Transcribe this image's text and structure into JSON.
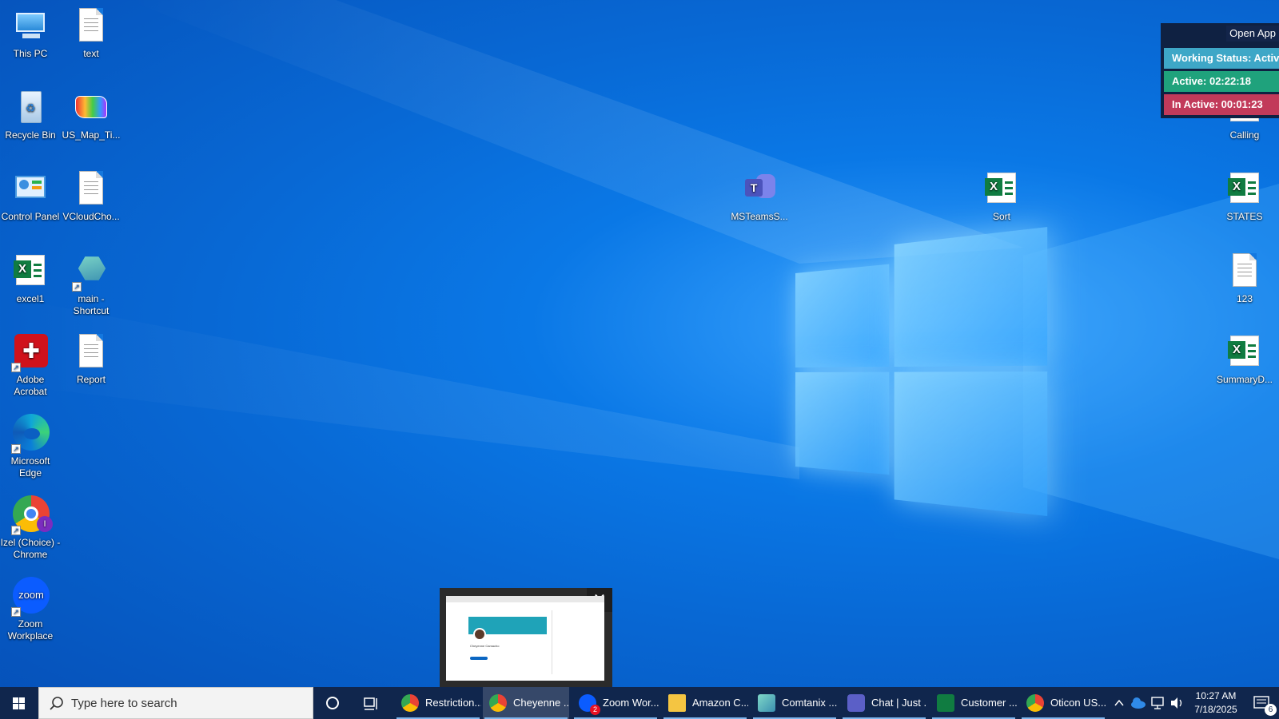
{
  "desktop": {
    "icons": [
      {
        "label": "This PC",
        "icon": "this-pc-icon"
      },
      {
        "label": "text",
        "icon": "text-file-icon"
      },
      {
        "label": "Recycle Bin",
        "icon": "recycle-bin-icon"
      },
      {
        "label": "US_Map_Ti...",
        "icon": "map-image-icon"
      },
      {
        "label": "Control Panel",
        "icon": "control-panel-icon"
      },
      {
        "label": "VCloudCho...",
        "icon": "text-file-icon"
      },
      {
        "label": "excel1",
        "icon": "excel-file-icon"
      },
      {
        "label": "main - Shortcut",
        "icon": "shortcut-icon"
      },
      {
        "label": "Adobe Acrobat",
        "icon": "adobe-acrobat-icon"
      },
      {
        "label": "Report",
        "icon": "text-file-icon"
      },
      {
        "label": "Microsoft Edge",
        "icon": "edge-icon"
      },
      {
        "label": "Izel (Choice) - Chrome",
        "icon": "chrome-icon"
      },
      {
        "label": "Zoom Workplace",
        "icon": "zoom-icon"
      },
      {
        "label": "MSTeamsS...",
        "icon": "teams-icon"
      },
      {
        "label": "Sort",
        "icon": "excel-file-icon"
      },
      {
        "label": "Calling",
        "icon": "excel-file-icon"
      },
      {
        "label": "STATES",
        "icon": "excel-file-icon"
      },
      {
        "label": "123",
        "icon": "text-file-icon"
      },
      {
        "label": "SummaryD...",
        "icon": "excel-file-icon"
      }
    ]
  },
  "widget": {
    "open_app": "Open App",
    "working_status": "Working Status: Active",
    "active": "Active: 02:22:18",
    "inactive": "In Active: 00:01:23",
    "colors": {
      "status": "#3ea7c7",
      "active": "#1fa27c",
      "inactive": "#c23a5a"
    }
  },
  "taskbar": {
    "search_placeholder": "Type here to search",
    "apps": [
      {
        "label": "Restriction...",
        "icon": "chrome-icon"
      },
      {
        "label": "Cheyenne ...",
        "icon": "chrome-icon"
      },
      {
        "label": "Zoom Wor...",
        "icon": "zoom-icon"
      },
      {
        "label": "Amazon C...",
        "icon": "file-explorer-icon"
      },
      {
        "label": "Comtanix ...",
        "icon": "comtanix-icon"
      },
      {
        "label": "Chat | Just ...",
        "icon": "teams-icon"
      },
      {
        "label": "Customer ...",
        "icon": "excel-icon"
      },
      {
        "label": "Oticon US...",
        "icon": "chrome-icon"
      }
    ],
    "zoom_badge": "2",
    "clock_time": "10:27 AM",
    "clock_date": "7/18/2025",
    "notification_count": "6"
  },
  "preview": {
    "profile_name": "Cheyenne Camacho"
  }
}
